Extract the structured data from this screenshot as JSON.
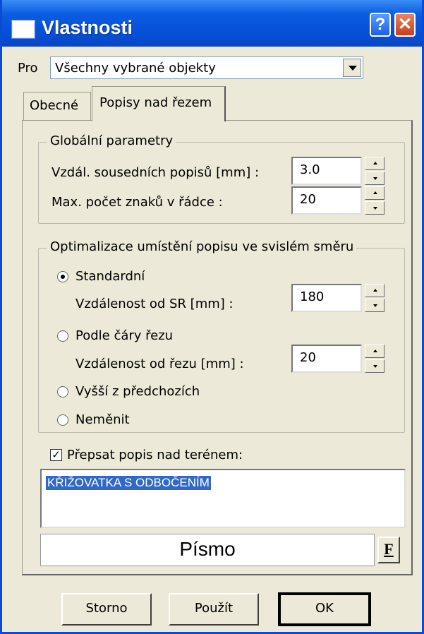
{
  "window": {
    "title": "Vlastnosti",
    "help_label": "?",
    "close_label": "✕"
  },
  "pro": {
    "label": "Pro",
    "selected": "Všechny vybrané objekty"
  },
  "tabs": [
    {
      "label": "Obecné"
    },
    {
      "label": "Popisy nad řezem"
    }
  ],
  "global": {
    "title": "Globální parametry",
    "spacing_label": "Vzdál. sousedních popisů [mm] :",
    "spacing_value": "3.0",
    "maxchars_label": "Max. počet znaků v řádce :",
    "maxchars_value": "20"
  },
  "optimization": {
    "title": "Optimalizace umístění popisu ve svislém směru",
    "options": [
      {
        "label": "Standardní",
        "checked": true
      },
      {
        "label": "Podle čáry řezu",
        "checked": false
      },
      {
        "label": "Vyšší z předchozích",
        "checked": false
      },
      {
        "label": "Neměnit",
        "checked": false
      }
    ],
    "sr_label": "Vzdálenost od SR [mm] :",
    "sr_value": "180",
    "cut_label": "Vzdálenost od řezu [mm] :",
    "cut_value": "20"
  },
  "override": {
    "label": "Přepsat popis nad terénem:",
    "checked": true,
    "text": "KŘIŽOVATKA S ODBOČENÍM"
  },
  "font": {
    "label": "Písmo",
    "button_label": "F"
  },
  "buttons": {
    "cancel": "Storno",
    "apply": "Použít",
    "ok": "OK"
  }
}
